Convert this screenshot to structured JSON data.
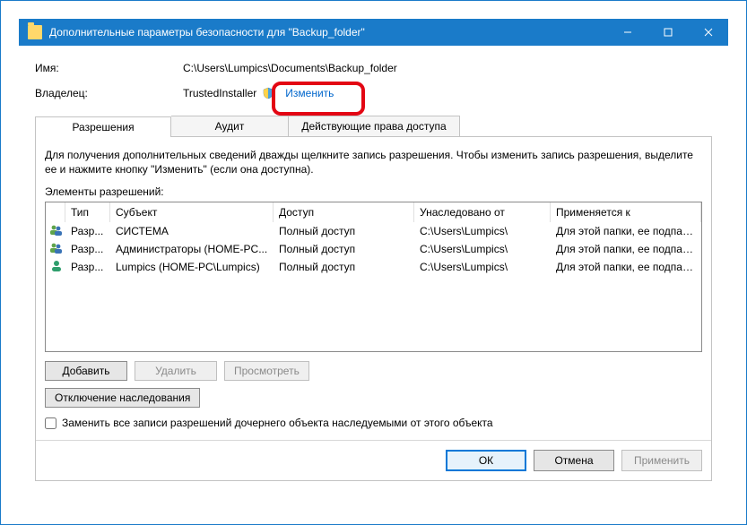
{
  "window": {
    "title": "Дополнительные параметры безопасности для \"Backup_folder\""
  },
  "info": {
    "name_label": "Имя:",
    "name_value": "C:\\Users\\Lumpics\\Documents\\Backup_folder",
    "owner_label": "Владелец:",
    "owner_value": "TrustedInstaller",
    "change_link": "Изменить"
  },
  "tabs": {
    "permissions": "Разрешения",
    "audit": "Аудит",
    "effective": "Действующие права доступа"
  },
  "hint": "Для получения дополнительных сведений дважды щелкните запись разрешения. Чтобы изменить запись разрешения, выделите ее и нажмите кнопку \"Изменить\" (если она доступна).",
  "list_label": "Элементы разрешений:",
  "columns": {
    "type": "Тип",
    "subject": "Субъект",
    "access": "Доступ",
    "inherited": "Унаследовано от",
    "applies": "Применяется к"
  },
  "rows": [
    {
      "icon": "group",
      "type": "Разр...",
      "subject": "СИСТЕМА",
      "access": "Полный доступ",
      "inherited": "C:\\Users\\Lumpics\\",
      "applies": "Для этой папки, ее подпапок ..."
    },
    {
      "icon": "group",
      "type": "Разр...",
      "subject": "Администраторы (HOME-PC...",
      "access": "Полный доступ",
      "inherited": "C:\\Users\\Lumpics\\",
      "applies": "Для этой папки, ее подпапок ..."
    },
    {
      "icon": "user",
      "type": "Разр...",
      "subject": "Lumpics (HOME-PC\\Lumpics)",
      "access": "Полный доступ",
      "inherited": "C:\\Users\\Lumpics\\",
      "applies": "Для этой папки, ее подпапок ..."
    }
  ],
  "buttons": {
    "add": "Добавить",
    "remove": "Удалить",
    "view": "Просмотреть",
    "disable_inh": "Отключение наследования"
  },
  "checkbox": "Заменить все записи разрешений дочернего объекта наследуемыми от этого объекта",
  "dlg": {
    "ok": "ОК",
    "cancel": "Отмена",
    "apply": "Применить"
  }
}
